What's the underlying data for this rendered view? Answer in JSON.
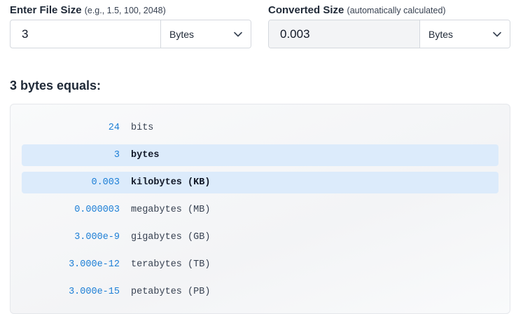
{
  "input": {
    "label": "Enter File Size",
    "hint": "(e.g., 1.5, 100, 2048)",
    "value": "3",
    "unit": "Bytes"
  },
  "output": {
    "label": "Converted Size",
    "hint": "(automatically calculated)",
    "value": "0.003",
    "unit": "Bytes"
  },
  "result_heading": "3 bytes equals:",
  "results": [
    {
      "value": "24",
      "unit": "bits",
      "highlighted": false
    },
    {
      "value": "3",
      "unit": "bytes",
      "highlighted": true
    },
    {
      "value": "0.003",
      "unit": "kilobytes (KB)",
      "highlighted": true
    },
    {
      "value": "0.000003",
      "unit": "megabytes (MB)",
      "highlighted": false
    },
    {
      "value": "3.000e-9",
      "unit": "gigabytes (GB)",
      "highlighted": false
    },
    {
      "value": "3.000e-12",
      "unit": "terabytes (TB)",
      "highlighted": false
    },
    {
      "value": "3.000e-15",
      "unit": "petabytes (PB)",
      "highlighted": false
    }
  ],
  "colors": {
    "accent": "#1d7fd6",
    "highlight": "#dcebfb"
  }
}
